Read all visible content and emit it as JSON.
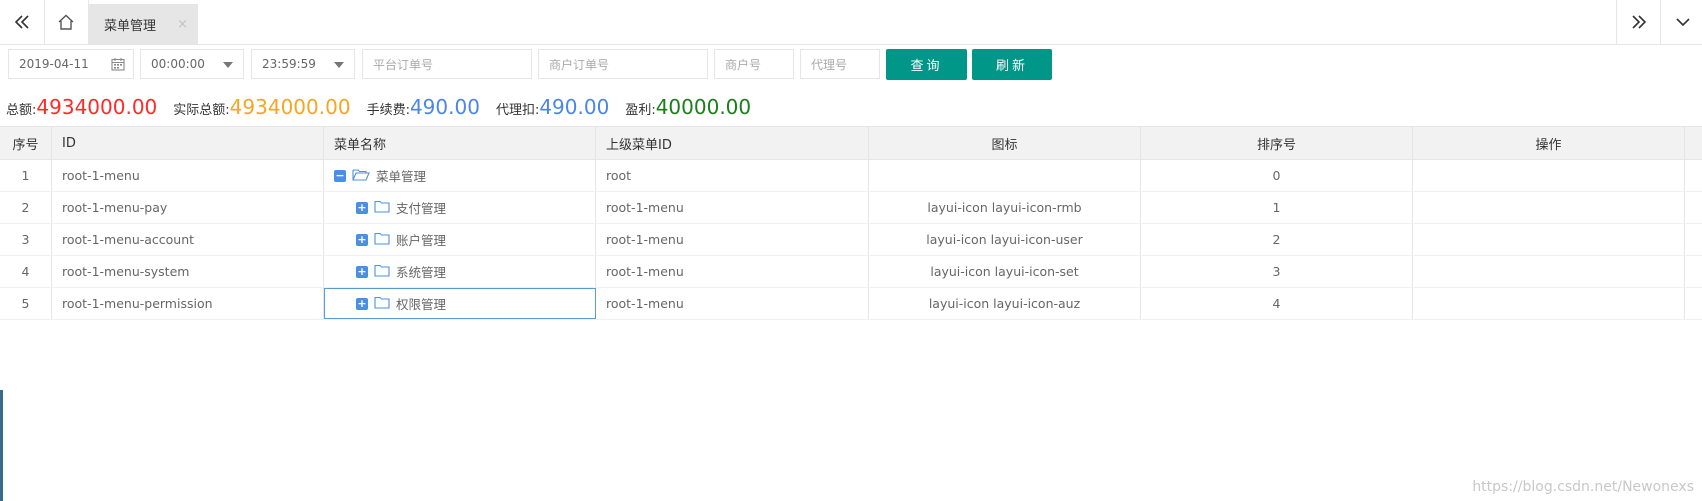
{
  "tabbar": {
    "active_tab": "菜单管理",
    "close_glyph": "×"
  },
  "filters": {
    "date": "2019-04-11",
    "start_time": "00:00:00",
    "end_time": "23:59:59",
    "platform_order_placeholder": "平台订单号",
    "merchant_order_placeholder": "商户订单号",
    "merchant_no_placeholder": "商户号",
    "agent_no_placeholder": "代理号",
    "query_label": "查询",
    "refresh_label": "刷新"
  },
  "totals": {
    "total_label": "总额:",
    "total_value": "4934000.00",
    "actual_label": "实际总额:",
    "actual_value": "4934000.00",
    "fee_label": "手续费:",
    "fee_value": "490.00",
    "agent_label": "代理扣:",
    "agent_value": "490.00",
    "profit_label": "盈利:",
    "profit_value": "40000.00",
    "colors": {
      "total": "#ff2a2a",
      "actual": "#f5a623",
      "fee": "#4a86e8",
      "agent": "#4a86e8",
      "profit": "#1a7f1a"
    }
  },
  "table": {
    "headers": [
      "序号",
      "ID",
      "菜单名称",
      "上级菜单ID",
      "图标",
      "排序号",
      "操作"
    ],
    "rows": [
      {
        "idx": "1",
        "id": "root-1-menu",
        "name": "菜单管理",
        "pid": "root",
        "icon": "",
        "sort": "0",
        "expanded": true
      },
      {
        "idx": "2",
        "id": "root-1-menu-pay",
        "name": "支付管理",
        "pid": "root-1-menu",
        "icon": "layui-icon layui-icon-rmb",
        "sort": "1",
        "expanded": false
      },
      {
        "idx": "3",
        "id": "root-1-menu-account",
        "name": "账户管理",
        "pid": "root-1-menu",
        "icon": "layui-icon layui-icon-user",
        "sort": "2",
        "expanded": false
      },
      {
        "idx": "4",
        "id": "root-1-menu-system",
        "name": "系统管理",
        "pid": "root-1-menu",
        "icon": "layui-icon layui-icon-set",
        "sort": "3",
        "expanded": false
      },
      {
        "idx": "5",
        "id": "root-1-menu-permission",
        "name": "权限管理",
        "pid": "root-1-menu",
        "icon": "layui-icon layui-icon-auz",
        "sort": "4",
        "expanded": false
      }
    ]
  },
  "watermark": "https://blog.csdn.net/Newonexs"
}
